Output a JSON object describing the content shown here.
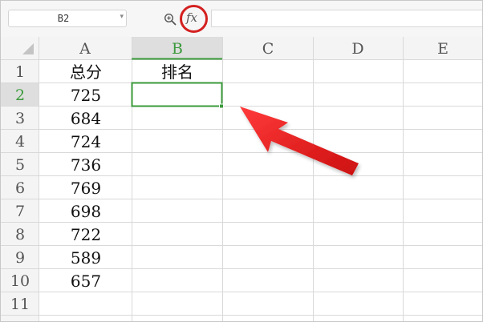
{
  "formula_bar": {
    "cell_reference": "B2",
    "dropdown_glyph": "▾",
    "zoom_icon": "zoom-magnifier-icon",
    "fx_label": "fx",
    "formula_value": ""
  },
  "sheet": {
    "columns": [
      "A",
      "B",
      "C",
      "D",
      "E"
    ],
    "rows": [
      "1",
      "2",
      "3",
      "4",
      "5",
      "6",
      "7",
      "8",
      "9",
      "10",
      "11"
    ],
    "active_column": "B",
    "active_row": "2",
    "cells": {
      "A1": "总分",
      "B1": "排名",
      "A2": "725",
      "A3": "684",
      "A4": "724",
      "A5": "736",
      "A6": "769",
      "A7": "698",
      "A8": "722",
      "A9": "589",
      "A10": "657"
    }
  },
  "colors": {
    "selection": "#3b9a3b",
    "annotation": "#e01b1b",
    "header_bg": "#f4f4f4",
    "active_header_bg": "#dedede",
    "gridline": "#d9d9d9"
  },
  "annotations": {
    "fx_highlight": "red-circle",
    "selected_cell_pointer": "red-arrow"
  }
}
